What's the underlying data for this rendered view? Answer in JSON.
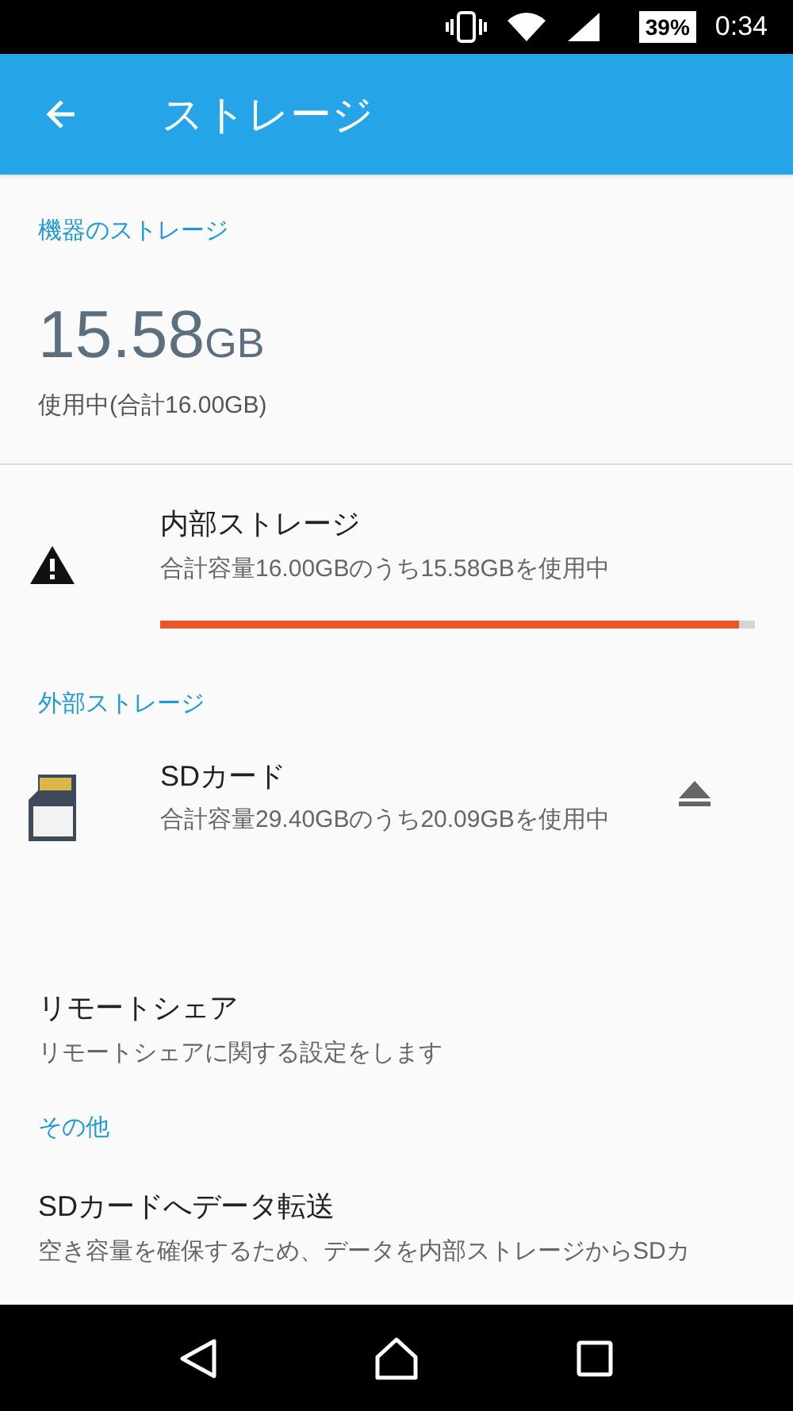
{
  "status_bar": {
    "battery": "39%",
    "time": "0:34"
  },
  "app_bar": {
    "title": "ストレージ"
  },
  "device_storage": {
    "header": "機器のストレージ",
    "used_value": "15.58",
    "used_unit": "GB",
    "used_caption": "使用中(合計16.00GB)"
  },
  "internal_storage": {
    "title": "内部ストレージ",
    "summary": "合計容量16.00GBのうち15.58GBを使用中",
    "level": 0.973
  },
  "external_storage": {
    "header": "外部ストレージ",
    "items": [
      {
        "title": "SDカード",
        "summary": "合計容量29.40GBのうち20.09GBを使用中"
      }
    ]
  },
  "remote_share": {
    "title": "リモートシェア",
    "summary": "リモートシェアに関する設定をします"
  },
  "other": {
    "header": "その他",
    "items": [
      {
        "title": "SDカードへデータ転送",
        "summary": "空き容量を確保するため、データを内部ストレージからSDカ"
      }
    ]
  }
}
